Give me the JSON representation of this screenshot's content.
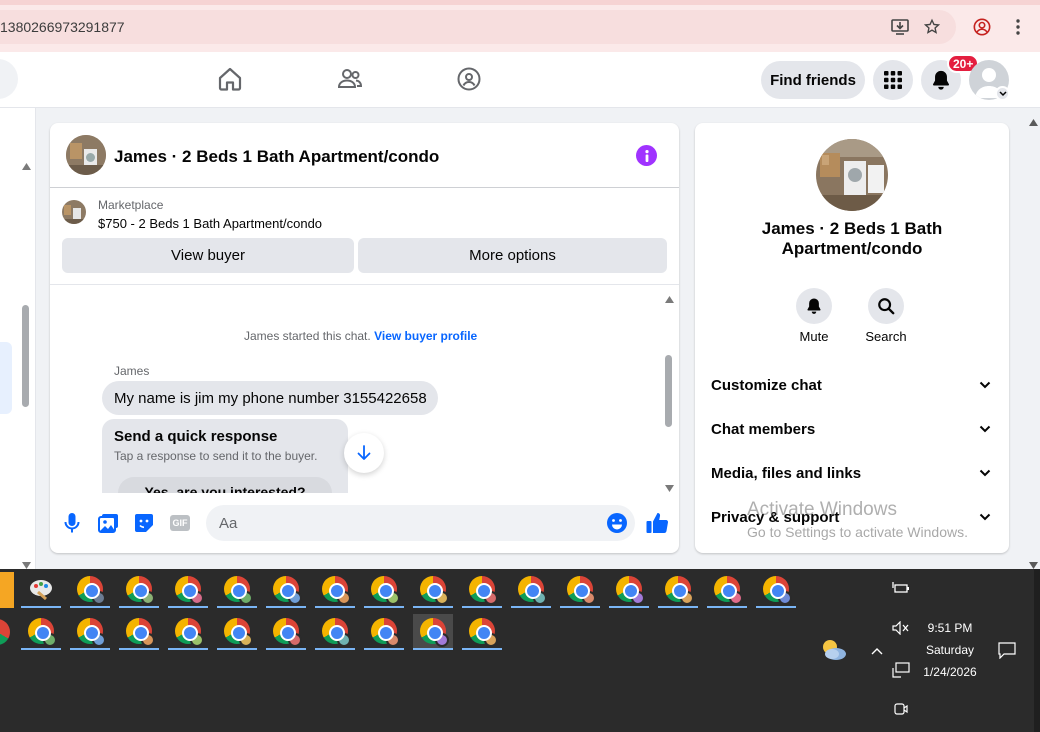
{
  "browser": {
    "url_fragment": "1380266973291877"
  },
  "header": {
    "find_friends_label": "Find friends",
    "notification_count": "20+"
  },
  "chat": {
    "title": "James · 2 Beds 1 Bath Apartment/condo",
    "listing_source": "Marketplace",
    "listing_price_title": "$750 - 2 Beds 1 Bath Apartment/condo",
    "view_buyer_label": "View buyer",
    "more_options_label": "More options",
    "system_message": "James started this chat.",
    "system_link": "View buyer profile",
    "sender_name": "James",
    "message_text": "My name is jim my phone number 3155422658",
    "quick_response_title": "Send a quick response",
    "quick_response_subtitle": "Tap a response to send it to the buyer.",
    "quick_response_option": "Yes, are you interested?",
    "composer_placeholder": "Aa"
  },
  "info_panel": {
    "title_line1": "James · 2 Beds 1 Bath",
    "title_line2": "Apartment/condo",
    "mute_label": "Mute",
    "search_label": "Search",
    "rows": [
      "Customize chat",
      "Chat members",
      "Media, files and links",
      "Privacy & support"
    ]
  },
  "watermark": {
    "line1": "Activate Windows",
    "line2": "Go to Settings to activate Windows."
  },
  "taskbar": {
    "time": "9:51 PM",
    "day": "Saturday",
    "date": "1/24/2026"
  },
  "colors": {
    "accent": "#0866ff",
    "info_purple": "#a033ff",
    "badge_red": "#e41e3f"
  }
}
